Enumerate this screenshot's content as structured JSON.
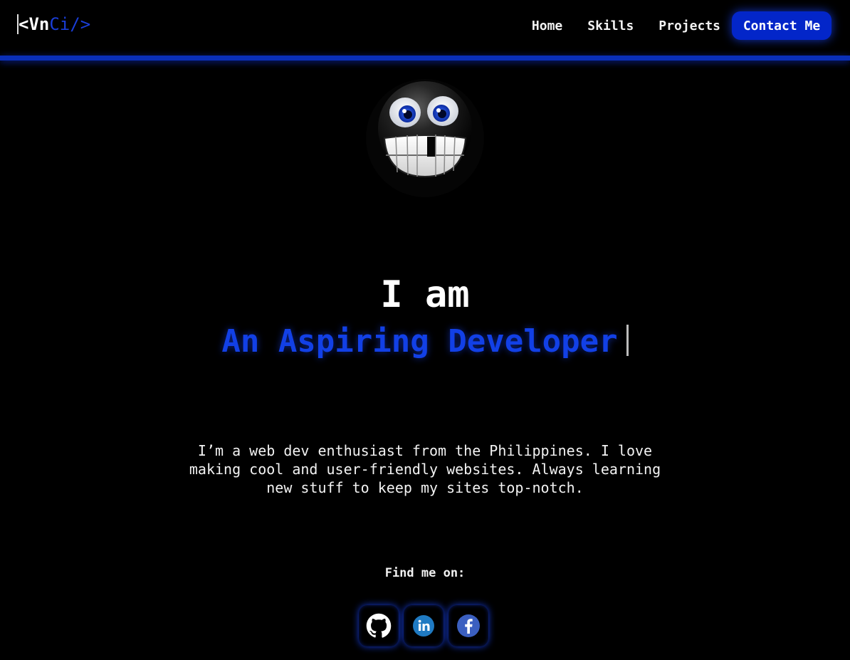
{
  "header": {
    "logo": {
      "open": "<Vn",
      "accent": "Ci/>"
    },
    "nav": [
      {
        "label": "Home"
      },
      {
        "label": "Skills"
      },
      {
        "label": "Projects"
      }
    ],
    "contact_label": "Contact Me"
  },
  "hero": {
    "intro": "I am",
    "role": "An Aspiring Developer",
    "bio": "I’m a web dev enthusiast from the Philippines. I love making cool and user-friendly websites. Always learning new stuff to keep my sites top-notch."
  },
  "social": {
    "label": "Find me on:",
    "links": [
      {
        "icon": "github-icon"
      },
      {
        "icon": "linkedin-icon"
      },
      {
        "icon": "facebook-icon"
      }
    ]
  },
  "colors": {
    "background": "#000000",
    "accent": "#0326c9",
    "role_text": "#1240e6"
  }
}
